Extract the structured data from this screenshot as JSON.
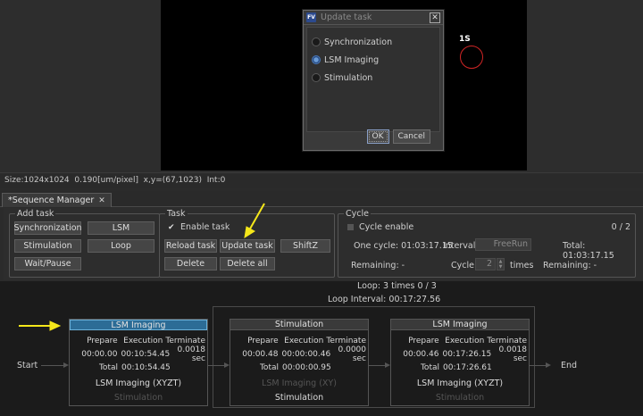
{
  "viewer": {
    "roi_label": "1S",
    "status_text": "Size:1024x1024  0.190[um/pixel]  x,y=(67,1023)  Int:0"
  },
  "dialog": {
    "title": "Update task",
    "logo_text": "FV",
    "close_glyph": "✕",
    "options": [
      {
        "label": "Synchronization",
        "selected": false
      },
      {
        "label": "LSM Imaging",
        "selected": true
      },
      {
        "label": "Stimulation",
        "selected": false
      }
    ],
    "ok_label": "OK",
    "cancel_label": "Cancel"
  },
  "tab": {
    "label": "*Sequence Manager",
    "close_glyph": "✕"
  },
  "add_task": {
    "title": "Add task",
    "synchronization": "Synchronization",
    "lsm": "LSM",
    "stimulation": "Stimulation",
    "loop": "Loop",
    "wait_pause": "Wait/Pause"
  },
  "task": {
    "title": "Task",
    "enable_label": "Enable task",
    "enable_checked": true,
    "reload": "Reload task",
    "update": "Update task",
    "shiftz": "ShiftZ",
    "delete": "Delete",
    "delete_all": "Delete all"
  },
  "cycle": {
    "title": "Cycle",
    "enable_label": "Cycle enable",
    "counter": "0 / 2",
    "one_cycle_label": "One cycle: 01:03:17.15",
    "interval_label": "Interval:",
    "interval_value": "FreeRun",
    "total_label": "Total: 01:03:17.15",
    "remaining1": "Remaining: -",
    "cycle_label": "Cycle:",
    "cycle_value": "2",
    "times_label": "times",
    "remaining2": "Remaining: -"
  },
  "flow": {
    "loop_text": "Loop:  3 times 0 / 3",
    "loop_interval": "Loop Interval:   00:17:27.56",
    "start_label": "Start",
    "end_label": "End",
    "headers": {
      "prepare": "Prepare",
      "execution": "Execution",
      "terminate": "Terminate",
      "total": "Total"
    },
    "nodes": [
      {
        "title": "LSM Imaging",
        "selected": true,
        "prepare": "00:00.00",
        "execution": "00:10:54.45",
        "terminate": "0.0018 sec",
        "total": "00:10:54.45",
        "task1": "LSM Imaging (XYZT)",
        "task2": "Stimulation",
        "task1_active": true
      },
      {
        "title": "Stimulation",
        "selected": false,
        "prepare": "00:00.48",
        "execution": "00:00:00.46",
        "terminate": "0.0000 sec",
        "total": "00:00:00.95",
        "task1": "LSM Imaging (XY)",
        "task2": "Stimulation",
        "task1_active": false
      },
      {
        "title": "LSM Imaging",
        "selected": false,
        "prepare": "00:00.46",
        "execution": "00:17:26.15",
        "terminate": "0.0018 sec",
        "total": "00:17:26.61",
        "task1": "LSM Imaging (XYZT)",
        "task2": "Stimulation",
        "task1_active": true
      }
    ]
  },
  "colors": {
    "annotation_arrow": "#f5e71a",
    "selected_node": "#2c6c96",
    "roi_circle": "#d02525"
  }
}
